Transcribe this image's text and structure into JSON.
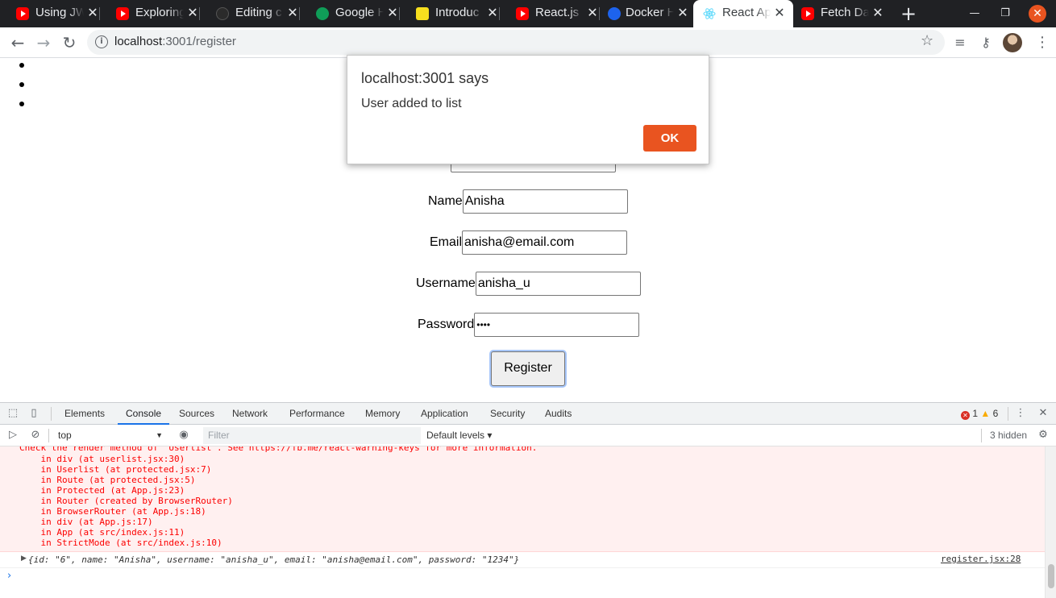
{
  "browser": {
    "tabs": [
      {
        "title": "Using JWT",
        "favicon": "youtube-icon"
      },
      {
        "title": "Exploring",
        "favicon": "youtube-icon"
      },
      {
        "title": "Editing c",
        "favicon": "github-icon"
      },
      {
        "title": "Google H",
        "favicon": "hangouts-icon"
      },
      {
        "title": "Introduc",
        "favicon": "js-icon"
      },
      {
        "title": "React.js",
        "favicon": "youtube-icon"
      },
      {
        "title": "Docker H",
        "favicon": "docker-icon"
      },
      {
        "title": "React Ap",
        "favicon": "react-icon",
        "active": true
      },
      {
        "title": "Fetch Da",
        "favicon": "youtube-icon"
      }
    ],
    "address": {
      "host": "localhost",
      "path": ":3001/register"
    }
  },
  "form": {
    "fields": [
      {
        "label": "Name",
        "value": "Anisha"
      },
      {
        "label": "Email",
        "value": "anisha@email.com"
      },
      {
        "label": "Username",
        "value": "anisha_u"
      },
      {
        "label": "Password",
        "value": "••••"
      }
    ],
    "submit_label": "Register"
  },
  "dialog": {
    "title": "localhost:3001 says",
    "message": "User added to list",
    "ok_label": "OK"
  },
  "devtools": {
    "tabs": [
      "Elements",
      "Console",
      "Sources",
      "Network",
      "Performance",
      "Memory",
      "Application",
      "Security",
      "Audits"
    ],
    "active_tab": "Console",
    "error_count": "1",
    "warning_count": "6",
    "context": "top",
    "filter_placeholder": "Filter",
    "levels": "Default levels",
    "hidden": "3 hidden",
    "error_lines": [
      "Check the render method of `Userlist`. See https://fb.me/react-warning-keys for more information.",
      "    in div (at userlist.jsx:30)",
      "    in Userlist (at protected.jsx:7)",
      "    in Route (at protected.jsx:5)",
      "    in Protected (at App.js:23)",
      "    in Router (created by BrowserRouter)",
      "    in BrowserRouter (at App.js:18)",
      "    in div (at App.js:17)",
      "    in App (at src/index.js:11)",
      "    in StrictMode (at src/index.js:10)"
    ],
    "log": {
      "text": "{id: \"6\", name: \"Anisha\", username: \"anisha_u\", email: \"anisha@email.com\", password: \"1234\"}",
      "source": "register.jsx:28"
    },
    "colors": {
      "error_text": "#fc0000",
      "error_bg": "#fff0f0",
      "accent": "#1a73e8"
    }
  },
  "colors": {
    "dialog_button": "#e95420",
    "tabstrip": "#202124"
  }
}
